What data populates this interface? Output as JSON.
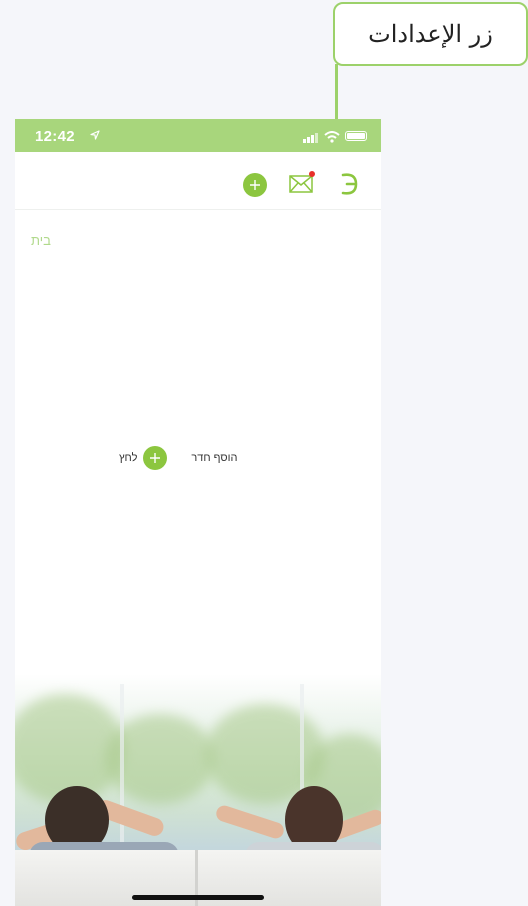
{
  "annotation": {
    "callout_text": "زر الإعدادات",
    "accent_color": "#9cd16a"
  },
  "status_bar": {
    "time": "12:42",
    "background": "#a8d67c"
  },
  "header": {
    "buttons": [
      {
        "name": "add",
        "icon": "plus-circle-icon"
      },
      {
        "name": "messages",
        "icon": "envelope-icon",
        "has_notification": true
      },
      {
        "name": "settings",
        "icon": "settings-icon"
      }
    ],
    "accent_color": "#8cc63f"
  },
  "main": {
    "home_label": "בית",
    "empty_hint": {
      "before": "לחץ",
      "after": "הוסף חדר"
    }
  }
}
